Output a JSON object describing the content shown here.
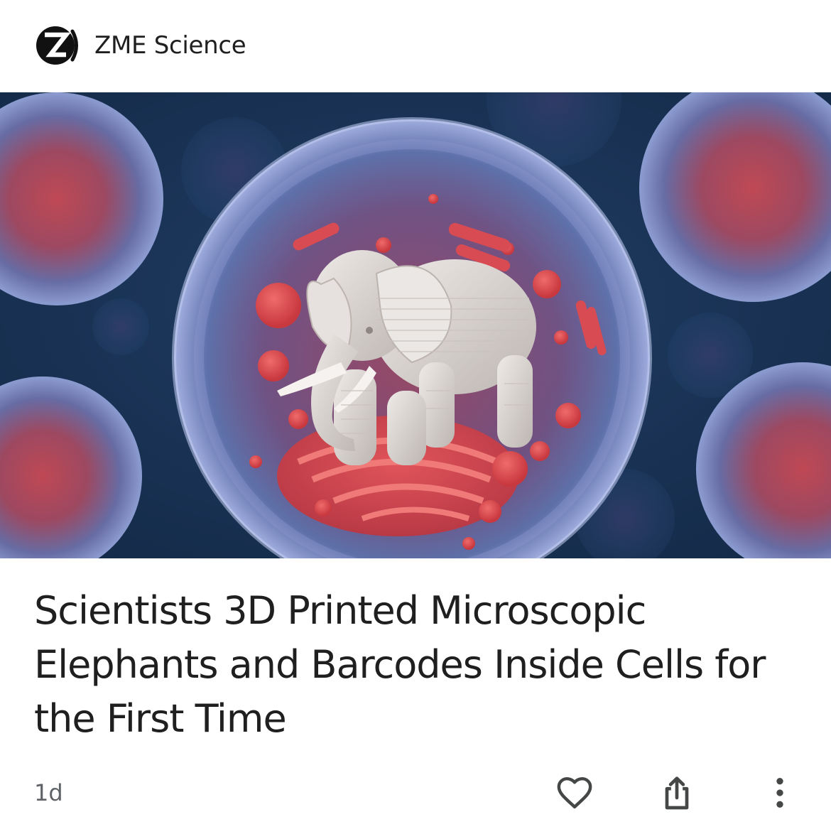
{
  "source": {
    "name": "ZME Science",
    "logo_icon": "zme-science-logo"
  },
  "article": {
    "headline": "Scientists 3D Printed Microscopic Elephants and Barcodes Inside Cells for the First Time",
    "age": "1d",
    "image_subject": "3D-printed microscopic elephant inside a cell"
  },
  "actions": {
    "like_icon": "heart-outline-icon",
    "share_icon": "share-icon",
    "more_icon": "more-vertical-icon"
  },
  "colors": {
    "text": "#1f1f1f",
    "meta_text": "#5f6368",
    "icon": "#444746",
    "hero_background": "#1c3558",
    "cell_membrane": "#7f8fc4",
    "organelle": "#d9474e",
    "elephant": "#dcd6d2"
  }
}
